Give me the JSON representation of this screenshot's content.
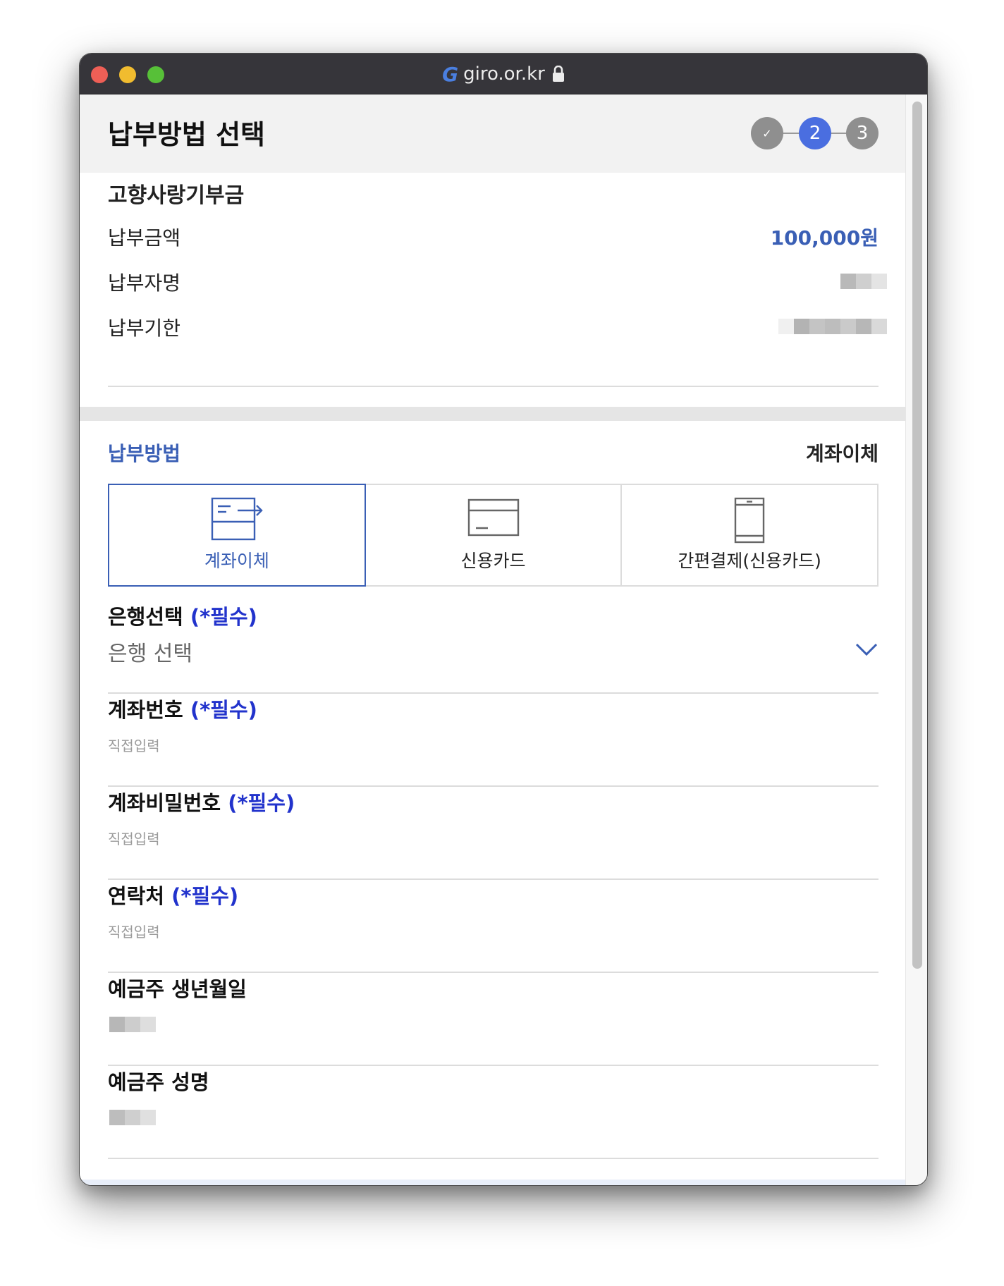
{
  "browser": {
    "url": "giro.or.kr",
    "logo_text": "G"
  },
  "header": {
    "title": "납부방법 선택",
    "steps": [
      {
        "label": "✓",
        "state": "done"
      },
      {
        "label": "2",
        "state": "active"
      },
      {
        "label": "3",
        "state": "todo"
      }
    ]
  },
  "summary": {
    "section_title": "고향사랑기부금",
    "amount_label": "납부금액",
    "amount_value": "100,000원",
    "payer_label": "납부자명",
    "due_label": "납부기한"
  },
  "method": {
    "label": "납부방법",
    "selected_value": "계좌이체",
    "tabs": [
      {
        "label": "계좌이체",
        "icon": "bank-transfer-icon"
      },
      {
        "label": "신용카드",
        "icon": "credit-card-icon"
      },
      {
        "label": "간편결제(신용카드)",
        "icon": "mobile-phone-icon"
      }
    ]
  },
  "form": {
    "required_mark": "(*필수)",
    "bank": {
      "label": "은행선택",
      "value": "은행 선택"
    },
    "account": {
      "label": "계좌번호",
      "placeholder": "직접입력"
    },
    "password": {
      "label": "계좌비밀번호",
      "placeholder": "직접입력"
    },
    "contact": {
      "label": "연락처",
      "placeholder": "직접입력"
    },
    "birth": {
      "label": "예금주 생년월일"
    },
    "holder": {
      "label": "예금주 성명"
    }
  },
  "colors": {
    "accent": "#3a5fb5",
    "step_active": "#4a6ee0",
    "required": "#2233cc"
  }
}
